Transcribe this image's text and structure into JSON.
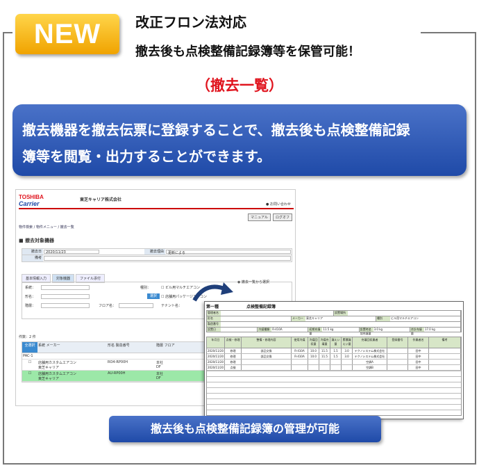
{
  "badge": "NEW",
  "headline1": "改正フロン法対応",
  "headline2": "撤去後も点検整備記録簿等を保管可能！",
  "section_title": "（撤去一覧）",
  "banner_line1": "撤去機器を撤去伝票に登録することで、撤去後も点検整備記録",
  "banner_line2": "簿等を閲覧・出力することができます。",
  "shot": {
    "logo_top": "TOSHIBA",
    "logo_bottom": "Carrier",
    "company": "東芝キャリア株式会社",
    "help": "お問い合わせ",
    "btn_manual": "マニュアル",
    "btn_logout": "ログオフ",
    "breadcrumb": "物件検索 / 物件メニュー / 撤去一覧",
    "subtitle": "撤去対象機器",
    "f_date_label": "撤去日",
    "f_date_value": "2020/11/23",
    "f_reason_label": "撤去理由",
    "f_reason_value": "更新による",
    "f_note_label": "備考",
    "tab1": "基本情報入力",
    "tab2": "対象機器",
    "tab3": "ファイル添付",
    "s_kind": "系統：",
    "s_name": "形名：",
    "s_floor": "階層：",
    "s_floorname": "フロア名：",
    "s_tenant": "テナント名：",
    "s_type": "種別：",
    "s_opt1": "ビル用マルチエアコン",
    "s_opt2": "店舗用パッケージエアコン",
    "s_select_btn": "選択",
    "s_radio": "撤去一覧から選択",
    "count": "件数：2 件",
    "th_sel": "全選択",
    "th_kind": "系統 メーカー",
    "th_model": "形名 製造番号",
    "th_floor": "階層 フロア",
    "group": "PAC-1",
    "r1_kind": "店舗用カスタムエアコン",
    "r1_maker": "東芝キャリア",
    "r1_model": "RO4-RP00H",
    "r1_floor": "本社",
    "r1_floor2": "DF",
    "r2_kind": "店舗用カスタムエアコン",
    "r2_maker": "東芝キャリア",
    "r2_model": "AU-RP00H",
    "r2_floor": "本社",
    "r2_floor2": "DF"
  },
  "record": {
    "title": "第一種",
    "title2": "点検整備記録簿",
    "h_admin": "管理者名",
    "h_name": "形名",
    "h_place": "設置場所",
    "h_maker": "メーカー",
    "h_type": "種別",
    "h_maker_v": "東芝キャリア",
    "h_type_v": "ビル用マルチエアコン",
    "h_serial": "製造番号",
    "h_date": "設置日",
    "h_gas": "冷媒種類",
    "h_gas_v": "R-410A",
    "h_init": "初期充填量",
    "h_init_v": "11.5 kg",
    "h_chg": "設置時追加充填量",
    "h_chg_v": "3.0 kg",
    "h_total": "合計充填量",
    "h_total_v": "17.0 kg",
    "g_date": "年月日",
    "g_work": "点検・修理",
    "g_content": "整備・修理内容",
    "g_gas": "使用冷媒",
    "g_recov": "冷媒回収量",
    "g_fill": "冷媒充填量",
    "g_leak": "漏えい量",
    "g_stock": "累積漏えい量",
    "g_company": "充填回収業者",
    "g_reg": "登録番号",
    "g_worker": "作業者名",
    "g_note": "備考",
    "rows": [
      {
        "d": "2020/11/20",
        "w": "修理",
        "c": "部品交換",
        "g": "R-410A",
        "a": "10.0",
        "b": "11.5",
        "l": "1.5",
        "s": "3.0",
        "co": "テクノシステム株式会社",
        "wk": "田中"
      },
      {
        "d": "2020/11/20",
        "w": "修理",
        "c": "部品交換",
        "g": "R-410A",
        "a": "10.0",
        "b": "11.5",
        "l": "1.5",
        "s": "3.0",
        "co": "テクノシステム株式会社",
        "wk": "田中"
      },
      {
        "d": "2020/11/20",
        "w": "修理",
        "c": "",
        "g": "",
        "a": "",
        "b": "",
        "l": "",
        "s": "",
        "co": "空調A",
        "wk": "田中"
      },
      {
        "d": "2020/11/20",
        "w": "点検",
        "c": "",
        "g": "",
        "a": "",
        "b": "",
        "l": "",
        "s": "",
        "co": "空調B",
        "wk": "田中"
      }
    ]
  },
  "bottom_banner": "撤去後も点検整備記録簿の管理が可能",
  "colors": {
    "badge": "#f0a300",
    "banner": "#1f4aa8",
    "section": "#e0141e",
    "highlight_row": "#9ce8a8"
  }
}
